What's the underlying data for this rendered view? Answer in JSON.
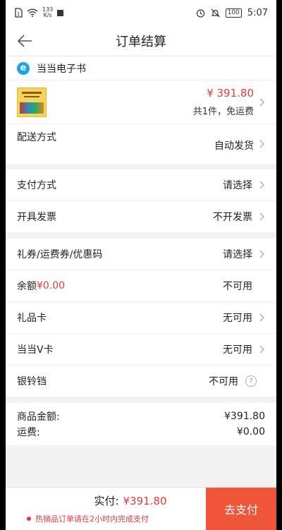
{
  "status_bar": {
    "speed_top": "133",
    "speed_unit": "K/s",
    "battery": "100",
    "time": "5:07"
  },
  "header": {
    "title": "订单结算"
  },
  "shop": {
    "name": "当当电子书",
    "logo_letter": "e"
  },
  "product": {
    "price": "¥ 391.80",
    "count_text": "共1件，免运费"
  },
  "shipping": {
    "label": "配送方式",
    "value": "自动发货"
  },
  "rows": [
    {
      "label": "支付方式",
      "value": "请选择"
    },
    {
      "label": "开具发票",
      "value": "不开发票"
    },
    {
      "label": "礼券/运费券/优惠码",
      "value": "请选择"
    },
    {
      "label": "余额",
      "label_amount": "¥0.00",
      "value": "不可用"
    },
    {
      "label": "礼品卡",
      "value": "无可用"
    },
    {
      "label": "当当V卡",
      "value": "无可用"
    },
    {
      "label": "银铃铛",
      "value": "不可用",
      "help": "?"
    }
  ],
  "summary": {
    "goods_label": "商品金额:",
    "goods_value": "¥391.80",
    "freight_label": "运费:",
    "freight_value": "¥0.00"
  },
  "bottom": {
    "total_label": "实付:",
    "total_value": "¥391.80",
    "notice": "热销品订单请在2小时内完成支付",
    "pay_button": "去支付"
  },
  "colors": {
    "accent": "#e4393c",
    "pay_button": "#f0553a"
  }
}
